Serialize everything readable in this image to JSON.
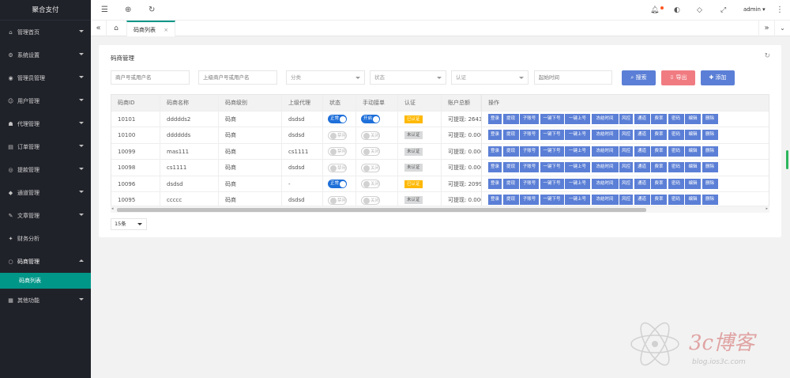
{
  "app": {
    "title": "聚合支付"
  },
  "sidebar": {
    "items": [
      {
        "label": "管理首页",
        "icon": "home-icon",
        "glyph": "⌂"
      },
      {
        "label": "系统设置",
        "icon": "gear-icon",
        "glyph": "⚙"
      },
      {
        "label": "管理员管理",
        "icon": "user-icon",
        "glyph": "◉"
      },
      {
        "label": "用户管理",
        "icon": "user-icon",
        "glyph": "☺"
      },
      {
        "label": "代理管理",
        "icon": "agent-icon",
        "glyph": "☗"
      },
      {
        "label": "订单管理",
        "icon": "cart-icon",
        "glyph": "▤"
      },
      {
        "label": "提款管理",
        "icon": "money-icon",
        "glyph": "◎"
      },
      {
        "label": "通道管理",
        "icon": "diamond-icon",
        "glyph": "◆"
      },
      {
        "label": "文章管理",
        "icon": "doc-icon",
        "glyph": "✎"
      },
      {
        "label": "财务分析",
        "icon": "chart-icon",
        "glyph": "✦"
      },
      {
        "label": "码商管理",
        "icon": "circle-icon",
        "glyph": "○"
      },
      {
        "label": "其他功能",
        "icon": "calendar-icon",
        "glyph": "▦"
      }
    ],
    "active_sub": "码商列表"
  },
  "topbar": {
    "user": "admin"
  },
  "tabs": {
    "current": "码商列表",
    "close": "×"
  },
  "card": {
    "title": "码商管理"
  },
  "filters": {
    "merchant_placeholder": "商户号或用户名",
    "parent_placeholder": "上级商户号或用户名",
    "category": "分类",
    "status": "状态",
    "auth": "认证",
    "start_time_placeholder": "起始时间"
  },
  "buttons": {
    "search": "搜索",
    "export": "导出",
    "add": "添加"
  },
  "colors": {
    "sidebar_bg": "#20222a",
    "accent": "#009688",
    "search_btn": "#5b7fd6",
    "export_btn": "#f07c82",
    "op_btn": "#5b7fd6"
  },
  "table": {
    "headers": [
      "码商ID",
      "码商名称",
      "码商级别",
      "上级代理",
      "状态",
      "手动接单",
      "认证",
      "账户总额",
      "操作"
    ],
    "rows": [
      {
        "id": "10101",
        "name": "ddddds2",
        "level": "码商",
        "parent": "dsdsd",
        "status": "正常",
        "status_on": true,
        "manual": "开启",
        "manual_on": true,
        "auth": "已认证",
        "auth_ok": true,
        "balance": "可提现: 2643"
      },
      {
        "id": "10100",
        "name": "dddddds",
        "level": "码商",
        "parent": "dsdsd",
        "status": "禁用",
        "status_on": false,
        "manual": "关闭",
        "manual_on": false,
        "auth": "未认证",
        "auth_ok": false,
        "balance": "可提现: 0.000"
      },
      {
        "id": "10099",
        "name": "mas111",
        "level": "码商",
        "parent": "cs1111",
        "status": "禁用",
        "status_on": false,
        "manual": "关闭",
        "manual_on": false,
        "auth": "未认证",
        "auth_ok": false,
        "balance": "可提现: 0.000"
      },
      {
        "id": "10098",
        "name": "cs1111",
        "level": "码商",
        "parent": "dsdsd",
        "status": "禁用",
        "status_on": false,
        "manual": "关闭",
        "manual_on": false,
        "auth": "未认证",
        "auth_ok": false,
        "balance": "可提现: 0.000"
      },
      {
        "id": "10096",
        "name": "dsdsd",
        "level": "码商",
        "parent": "-",
        "status": "正常",
        "status_on": true,
        "manual": "关闭",
        "manual_on": false,
        "auth": "已认证",
        "auth_ok": true,
        "balance": "可提现: 2099"
      },
      {
        "id": "10095",
        "name": "ccccc",
        "level": "码商",
        "parent": "dsdsd",
        "status": "禁用",
        "status_on": false,
        "manual": "关闭",
        "manual_on": false,
        "auth": "未认证",
        "auth_ok": false,
        "balance": "可提现: 0.000"
      }
    ],
    "actions": [
      "登录",
      "提现",
      "子账号",
      "一键下号",
      "一键上号",
      "冻结时间",
      "风控",
      "通道",
      "费率",
      "密码",
      "编辑",
      "删除"
    ]
  },
  "pager": {
    "size": "15条"
  }
}
